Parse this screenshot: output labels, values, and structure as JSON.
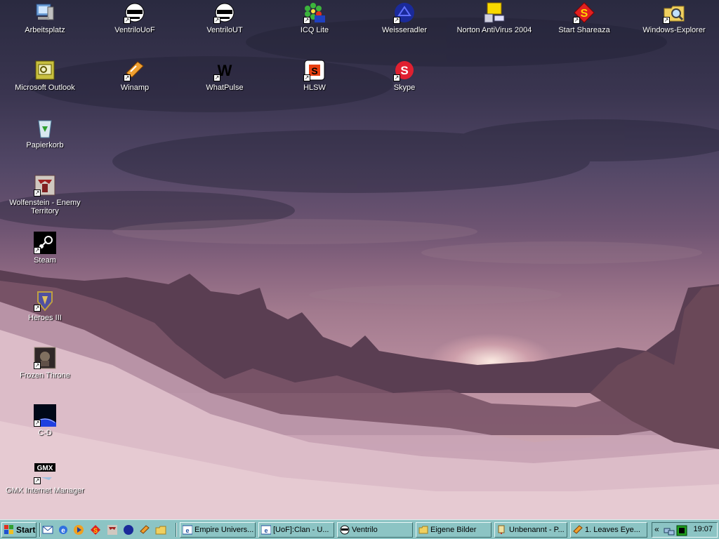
{
  "desktop": {
    "icons": [
      {
        "label": "Arbeitsplatz",
        "icon": "my-computer-icon",
        "shortcut": false
      },
      {
        "label": "VentriloUoF",
        "icon": "ventrilo-icon",
        "shortcut": true
      },
      {
        "label": "VentriloUT",
        "icon": "ventrilo-icon",
        "shortcut": true
      },
      {
        "label": "ICQ Lite",
        "icon": "icq-flower-icon",
        "shortcut": true
      },
      {
        "label": "Weisseradler",
        "icon": "eagle-icon",
        "shortcut": true
      },
      {
        "label": "Norton AntiVirus 2004",
        "icon": "norton-icon",
        "shortcut": false
      },
      {
        "label": "Start Shareaza",
        "icon": "shareaza-icon",
        "shortcut": true
      },
      {
        "label": "Windows-Explorer",
        "icon": "explorer-icon",
        "shortcut": true
      },
      {
        "label": "Microsoft Outlook",
        "icon": "outlook-icon",
        "shortcut": false
      },
      {
        "label": "Winamp",
        "icon": "winamp-icon",
        "shortcut": true
      },
      {
        "label": "WhatPulse",
        "icon": "whatpulse-icon",
        "shortcut": true
      },
      {
        "label": "HLSW",
        "icon": "hlsw-icon",
        "shortcut": true
      },
      {
        "label": "Skype",
        "icon": "skype-icon",
        "shortcut": true
      },
      {
        "label": "Papierkorb",
        "icon": "recycle-bin-icon",
        "shortcut": false
      },
      {
        "label": "Wolfenstein - Enemy Territory",
        "icon": "wolfenstein-icon",
        "shortcut": true
      },
      {
        "label": "Steam",
        "icon": "steam-icon",
        "shortcut": true
      },
      {
        "label": "Heroes III",
        "icon": "heroes-icon",
        "shortcut": true
      },
      {
        "label": "Frozen Throne",
        "icon": "frozen-throne-icon",
        "shortcut": true
      },
      {
        "label": "C-D",
        "icon": "cd-icon",
        "shortcut": true
      },
      {
        "label": "GMX Internet Manager",
        "icon": "gmx-icon",
        "shortcut": true
      }
    ]
  },
  "taskbar": {
    "start_label": "Start",
    "quick_launch": [
      "outlook-express-icon",
      "ie-icon",
      "media-player-icon",
      "shareaza-icon",
      "wolfenstein-icon",
      "eagle-icon",
      "winamp-icon",
      "folder-icon"
    ],
    "tasks": [
      {
        "label": "Empire Univers...",
        "icon": "ie-icon"
      },
      {
        "label": "[UoF]:Clan - U...",
        "icon": "ie-icon"
      },
      {
        "label": "Ventrilo",
        "icon": "ventrilo-icon"
      },
      {
        "label": "Eigene Bilder",
        "icon": "folder-icon"
      },
      {
        "label": "Unbenannt - P...",
        "icon": "paint-icon"
      },
      {
        "label": "1. Leaves Eye...",
        "icon": "winamp-icon"
      }
    ],
    "tray_expand": "«",
    "clock": "19:07"
  },
  "colors": {
    "taskbar": "#8cc4c4",
    "icon_text": "#ffffff"
  }
}
